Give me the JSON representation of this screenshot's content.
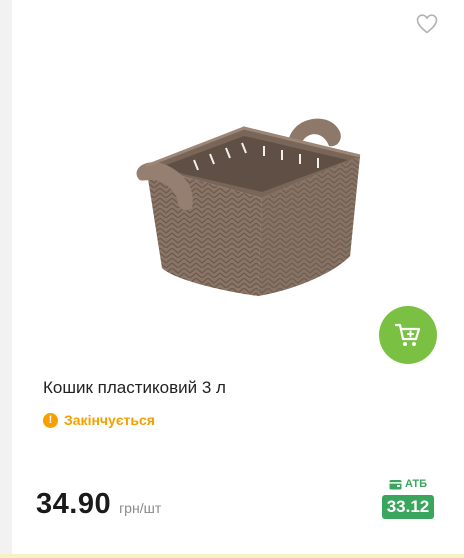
{
  "product": {
    "title": "Кошик пластиковий 3 л",
    "status": "Закінчується",
    "price": "34.90",
    "unit": "грн/шт",
    "card_label": "АТБ",
    "card_price": "33.12"
  },
  "icons": {
    "favorite": "heart-outline-icon",
    "cart": "cart-plus-icon",
    "status": "warning-icon",
    "card": "wallet-icon"
  },
  "colors": {
    "cart_button": "#7ac143",
    "status": "#f5a000",
    "card_price": "#3aa55d"
  }
}
